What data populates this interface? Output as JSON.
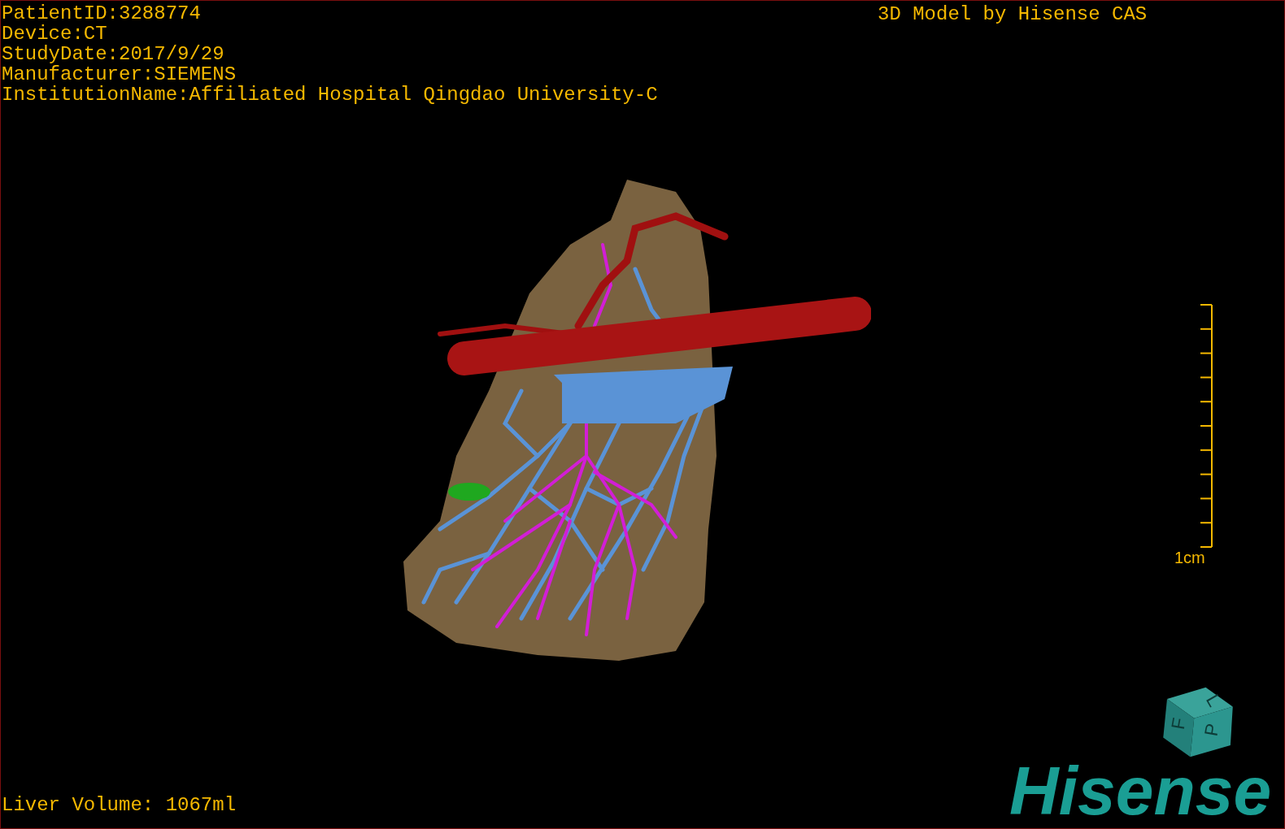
{
  "patient_info": [
    "PatientID:3288774",
    "Device:CT",
    "StudyDate:2017/9/29",
    "Manufacturer:SIEMENS",
    "InstitutionName:Affiliated Hospital Qingdao University-C"
  ],
  "caption": "3D Model by Hisense CAS",
  "scale_bar": {
    "label": "1cm"
  },
  "orientation_cube": {
    "faces": [
      "F",
      "L",
      "P"
    ]
  },
  "logo": "Hisense",
  "liver_volume": "Liver Volume: 1067ml"
}
